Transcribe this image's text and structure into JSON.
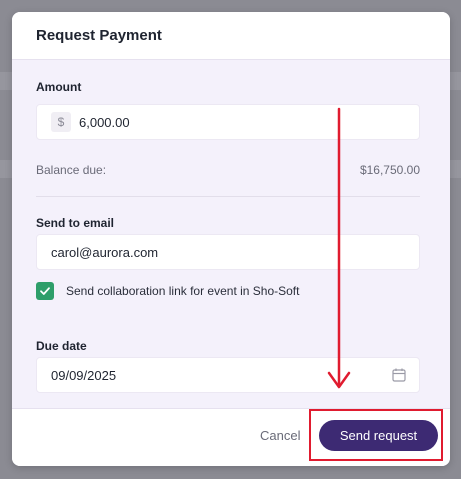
{
  "modal": {
    "title": "Request Payment"
  },
  "amount": {
    "label": "Amount",
    "currency_symbol": "$",
    "value": "6,000.00"
  },
  "balance": {
    "label": "Balance due:",
    "value": "$16,750.00"
  },
  "email": {
    "label": "Send to email",
    "value": "carol@aurora.com"
  },
  "collaboration": {
    "checked": true,
    "label": "Send collaboration link for event in Sho-Soft"
  },
  "due_date": {
    "label": "Due date",
    "value": "09/09/2025"
  },
  "footer": {
    "cancel_label": "Cancel",
    "send_label": "Send request"
  },
  "colors": {
    "primary": "#3d2a73",
    "checkbox": "#2e9e6a",
    "annotation": "#e01b2f"
  },
  "icons": {
    "calendar": "calendar-icon",
    "check": "check-icon"
  }
}
